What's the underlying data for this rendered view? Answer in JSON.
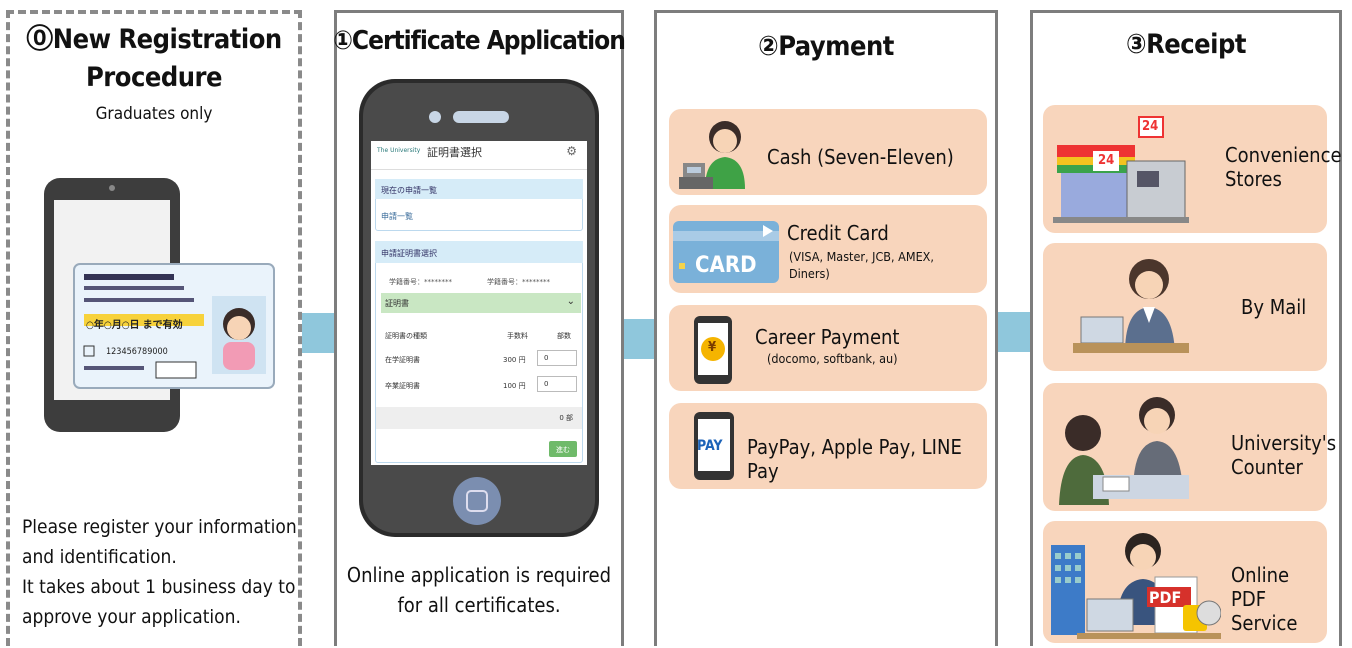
{
  "step0": {
    "title_line1": "⓪New Registration",
    "title_line2": "Procedure",
    "subtitle": "Graduates only",
    "id_card_text": "○年○月○日 まで有効",
    "id_card_number": "123456789000",
    "description": [
      "Please register your information",
      "and identification.",
      "It takes about 1 business day to",
      "approve your application."
    ]
  },
  "step1": {
    "title": "①Certificate Application",
    "phone_ui": {
      "header": "証明書選択",
      "brand": "The University",
      "section1": "現在の申請一覧",
      "link1": "申請一覧",
      "section2": "申請証明書選択",
      "field1": "学籍番号：********",
      "field2": "学籍番号：********",
      "select": "証明書",
      "col1": "証明書の種類",
      "col2": "手数料",
      "col3": "部数",
      "row1_name": "在学証明書",
      "row1_fee": "300 円",
      "row1_qty": "0",
      "row2_name": "卒業証明書",
      "row2_fee": "100 円",
      "row2_qty": "0",
      "total": "0 部",
      "next": "進む"
    },
    "description": [
      "Online application is required",
      "for all certificates."
    ]
  },
  "step2": {
    "title": "②Payment",
    "options": [
      {
        "label": "Cash (Seven-Eleven)",
        "icon": "cashier-icon"
      },
      {
        "label": "Credit Card",
        "detail": "(VISA, Master, JCB, AMEX, Diners)",
        "icon": "credit-card-icon",
        "icon_text": "CARD"
      },
      {
        "label": "Career Payment",
        "detail": "(docomo, softbank, au)",
        "icon": "mobile-yen-icon",
        "icon_text": "¥"
      },
      {
        "label": "PayPay, Apple Pay, LINE Pay",
        "icon": "mobile-pay-icon",
        "icon_text": "PAY"
      }
    ]
  },
  "step3": {
    "title": "③Receipt",
    "options": [
      {
        "label": "Convenience Stores",
        "icon": "convenience-store-icon",
        "icon_text": "24"
      },
      {
        "label": "By Mail",
        "icon": "mail-worker-icon"
      },
      {
        "label": "University's Counter",
        "icon": "counter-icon"
      },
      {
        "label": "Online PDF Service",
        "icon": "pdf-service-icon",
        "icon_text": "PDF"
      }
    ]
  },
  "colors": {
    "card_bg": "#f8d5bc",
    "arrow": "#8fc7dc",
    "panel_border": "#7d7d7d"
  }
}
